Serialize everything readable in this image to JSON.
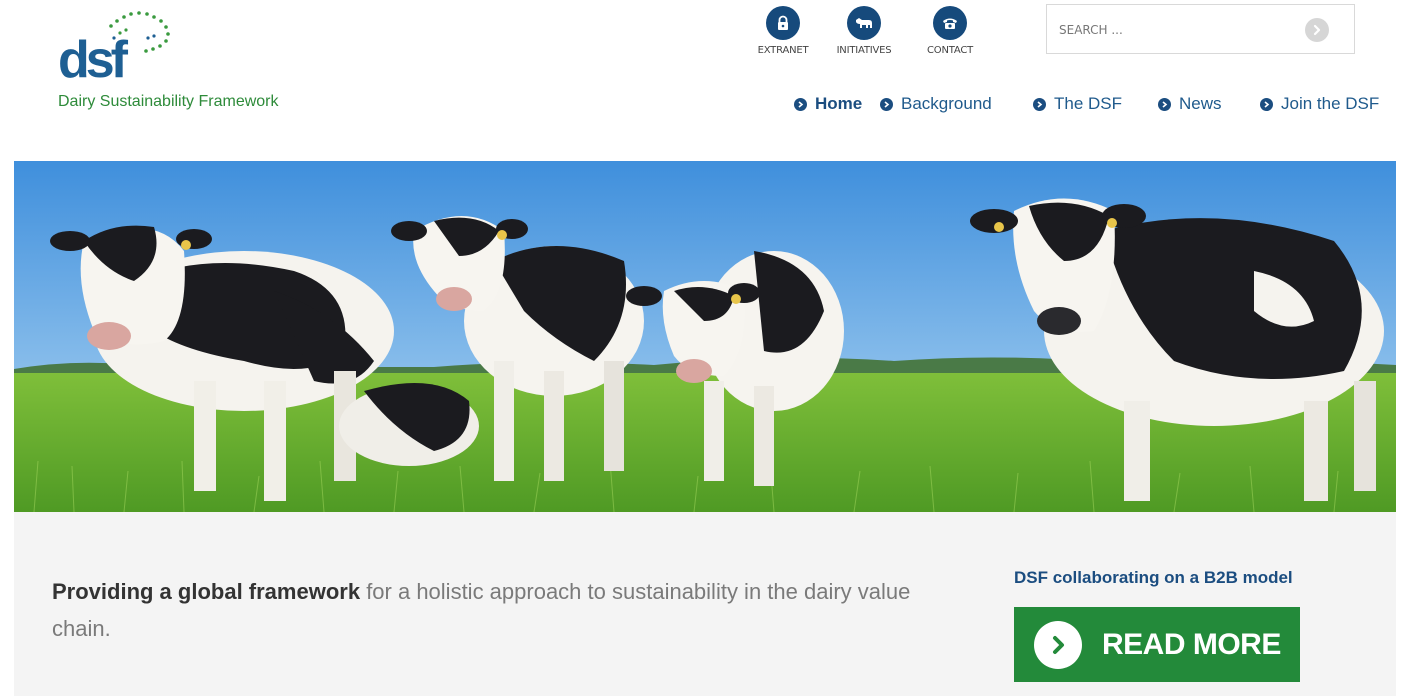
{
  "brand": {
    "logo_letters": "dsf",
    "tagline": "Dairy Sustainability Framework",
    "colors": {
      "primary": "#1e5f93",
      "green": "#2e8b3a",
      "button_green": "#238a3a"
    }
  },
  "utility_nav": [
    {
      "label": "EXTRANET",
      "icon": "lock-icon"
    },
    {
      "label": "INITIATIVES",
      "icon": "cow-icon"
    },
    {
      "label": "CONTACT",
      "icon": "phone-icon"
    }
  ],
  "search": {
    "placeholder": "SEARCH ...",
    "value": "",
    "icon": "arrow-right-icon"
  },
  "main_nav": [
    {
      "label": "Home",
      "active": true
    },
    {
      "label": "Background",
      "active": false
    },
    {
      "label": "The DSF",
      "active": false
    },
    {
      "label": "News",
      "active": false
    },
    {
      "label": "Join the DSF",
      "active": false
    }
  ],
  "hero": {
    "image": "Holstein cows standing on green pasture under blue sky"
  },
  "intro": {
    "strong": "Providing a global framework",
    "rest": " for a holistic approach to sustainability in the dairy value chain."
  },
  "promo": {
    "title": "DSF collaborating on a B2B model",
    "button_label": "READ MORE"
  }
}
